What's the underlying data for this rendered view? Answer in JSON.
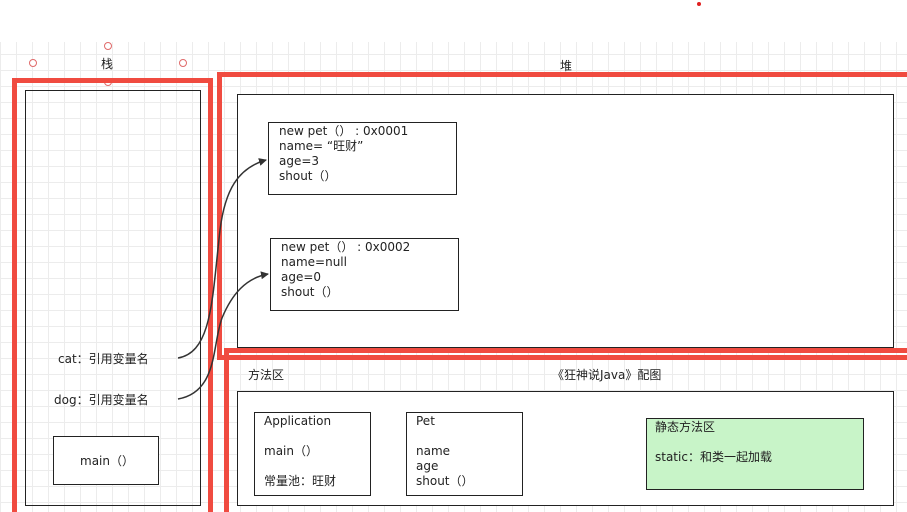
{
  "stack": {
    "title": "栈",
    "cat_ref": "cat：引用变量名",
    "dog_ref": "dog：引用变量名",
    "main_frame": "main（）"
  },
  "heap": {
    "title": "堆",
    "obj1": {
      "line1": "new pet（）   :   0x0001",
      "line2": "name= “旺财”",
      "line3": "age=3",
      "line4": "shout（）"
    },
    "obj2": {
      "line1": "new pet（）   :   0x0002",
      "line2": "name=null",
      "line3": "age=0",
      "line4": "shout（）"
    }
  },
  "method_area": {
    "title": "方法区",
    "caption": "《狂神说Java》配图",
    "application": {
      "title": "Application",
      "method": "main（）",
      "pool": "常量池：旺财"
    },
    "pet": {
      "title": "Pet",
      "field1": "name",
      "field2": "age",
      "method": "shout（）"
    },
    "static_area": {
      "title": "静态方法区",
      "note": "static：和类一起加载"
    }
  },
  "colors": {
    "frame_red": "#f04b40",
    "static_fill": "#c8f4c8",
    "border": "#222222"
  }
}
